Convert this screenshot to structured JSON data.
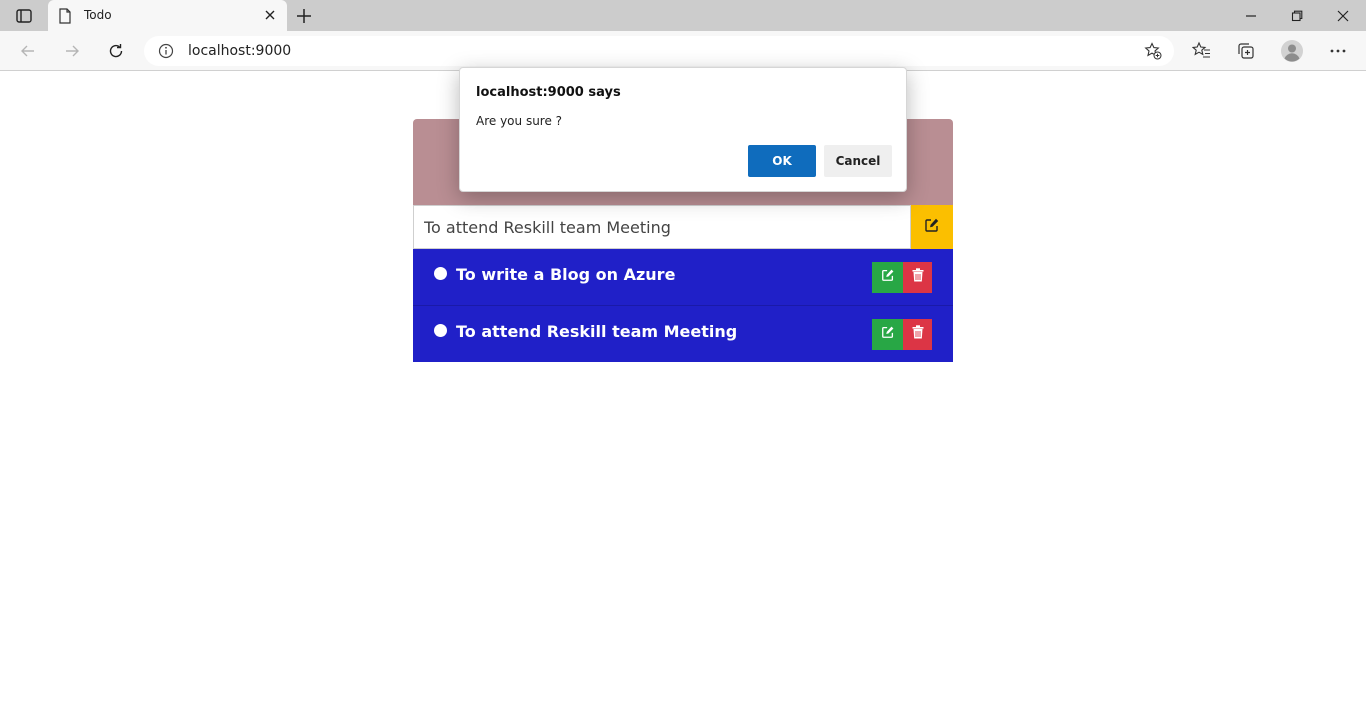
{
  "browser": {
    "tab_title": "Todo",
    "url": "localhost:9000",
    "icons": {
      "sidebar": "tab-actions-icon",
      "page": "document-icon",
      "close": "close-icon",
      "new_tab": "plus-icon",
      "minimize": "minimize-icon",
      "restore": "restore-icon",
      "close_window": "close-icon",
      "back": "back-arrow-icon",
      "forward": "forward-arrow-icon",
      "refresh": "refresh-icon",
      "info": "info-icon",
      "favorite": "add-favorite-icon",
      "favorites": "favorites-icon",
      "collections": "collections-icon",
      "profile": "profile-icon",
      "menu": "more-icon"
    }
  },
  "dialog": {
    "title": "localhost:9000 says",
    "message": "Are you sure ?",
    "ok_label": "OK",
    "cancel_label": "Cancel"
  },
  "todo": {
    "input_value": "To attend Reskill team Meeting",
    "items": [
      {
        "text": "To write a Blog on Azure"
      },
      {
        "text": "To attend Reskill team Meeting"
      }
    ]
  },
  "colors": {
    "header": "#b98e93",
    "list_bg": "#2020c8",
    "edit_yellow": "#fbbf00",
    "edit_green": "#28a745",
    "delete_red": "#dc3545",
    "ok_blue": "#0f6cbd"
  }
}
